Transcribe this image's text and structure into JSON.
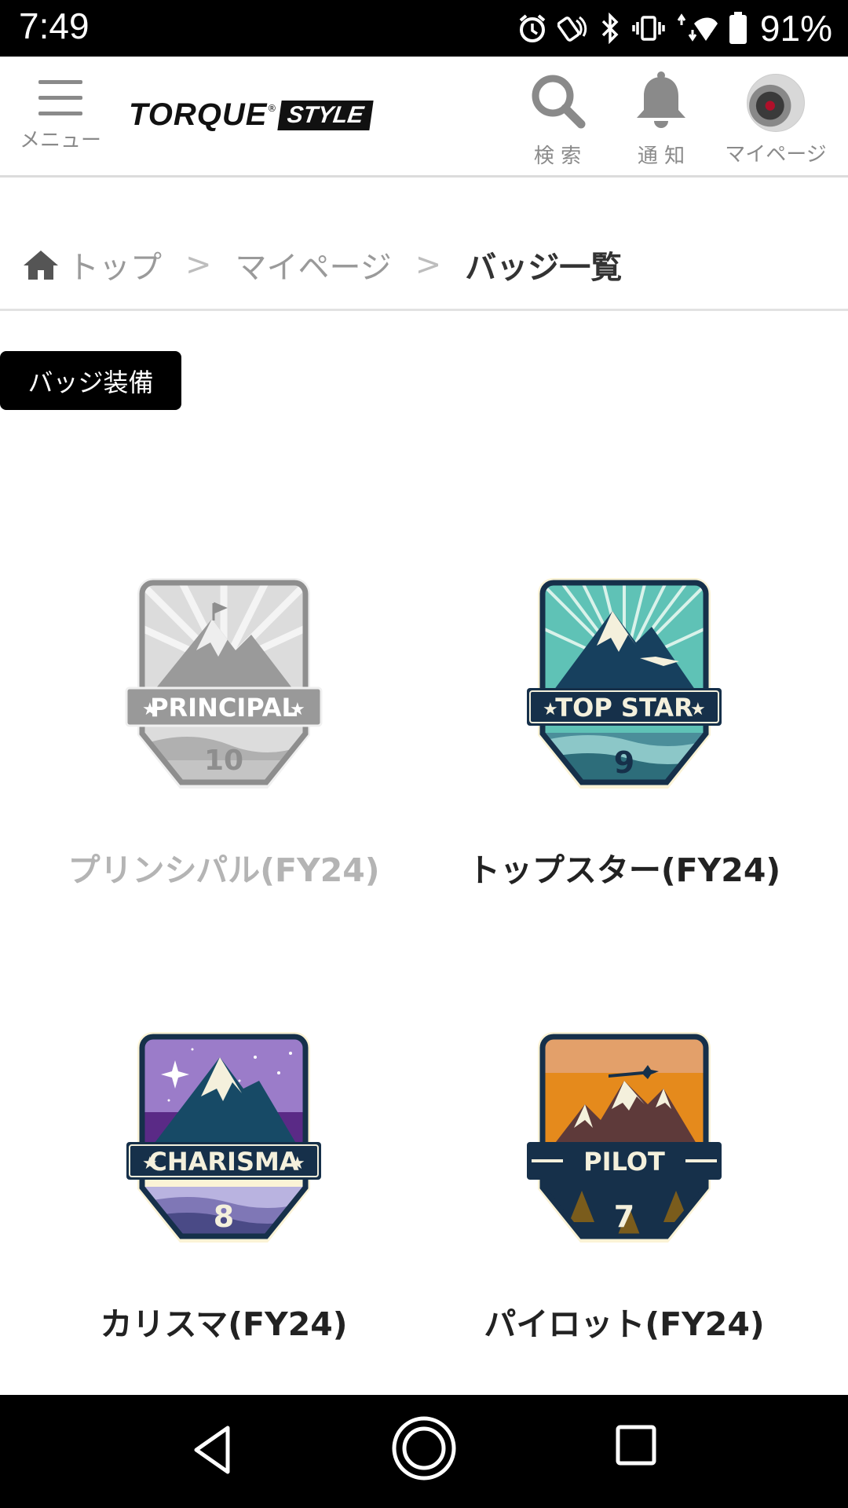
{
  "status_bar": {
    "time": "7:49",
    "battery": "91%",
    "icons": [
      "alarm-icon",
      "nfc-icon",
      "bluetooth-icon",
      "vibrate-icon",
      "wifi-icon",
      "battery-icon"
    ]
  },
  "header": {
    "menu_label": "メニュー",
    "logo_word": "TORQUE",
    "logo_badge": "STYLE",
    "search_label": "検 索",
    "notify_label": "通 知",
    "mypage_label": "マイページ"
  },
  "breadcrumb": {
    "home": "トップ",
    "separator": ">",
    "mypage": "マイページ",
    "current": "バッジ一覧"
  },
  "equip_button": "バッジ装備",
  "badges": [
    {
      "title": "PRINCIPAL",
      "number": "10",
      "name": "プリンシパル(FY24)",
      "active": false
    },
    {
      "title": "TOP STAR",
      "number": "9",
      "name": "トップスター(FY24)",
      "active": true
    },
    {
      "title": "CHARISMA",
      "number": "8",
      "name": "カリスマ(FY24)",
      "active": true
    },
    {
      "title": "PILOT",
      "number": "7",
      "name": "パイロット(FY24)",
      "active": true
    }
  ],
  "colors": {
    "status_bar_bg": "#000000",
    "header_icon_gray": "#8a8a8a",
    "accent_black": "#000000",
    "inactive_text": "#b4b4b4"
  }
}
